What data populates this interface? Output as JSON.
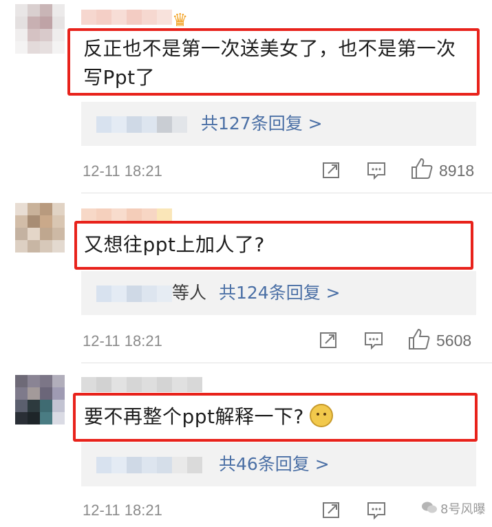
{
  "comments": [
    {
      "text": "反正也不是第一次送美女了，也不是第一次\n写Ppt了",
      "replies": {
        "others": "",
        "count_text": "共127条回复 >"
      },
      "time": "12-11 18:21",
      "likes": "8918",
      "has_crown_badge": true
    },
    {
      "text": "又想往ppt上加人了?",
      "replies": {
        "others": "等人",
        "count_text": "共124条回复 >"
      },
      "time": "12-11 18:21",
      "likes": "5608",
      "has_crown_badge": false
    },
    {
      "text": "要不再整个ppt解释一下?",
      "replies": {
        "others": "",
        "count_text": "共46条回复 >"
      },
      "time": "12-11 18:21",
      "likes": "",
      "has_crown_badge": false
    }
  ],
  "watermark": "8号风曝",
  "colors": {
    "highlight_border": "#e8221b",
    "link": "#4a6fa5",
    "reply_bg": "#f2f2f2"
  }
}
